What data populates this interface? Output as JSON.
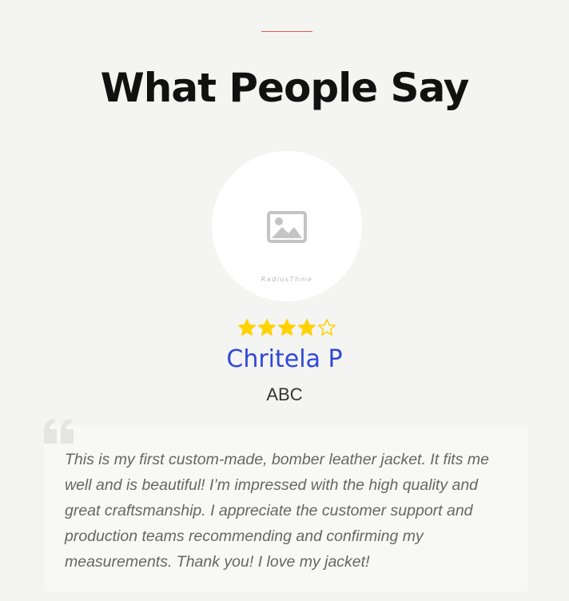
{
  "section": {
    "title": "What People Say",
    "accent_color": "#e8544a"
  },
  "testimonial": {
    "avatar_icon": "image-placeholder-icon",
    "avatar_watermark": "RadiusThme",
    "rating": 4,
    "rating_max": 5,
    "star_color": "#ffd200",
    "name": "Chritela P",
    "name_color": "#2f48d6",
    "company": "ABC",
    "quote_icon": "quote-icon",
    "quote": "This is my first custom-made, bomber leather jacket. It fits me well and is beautiful! I’m impressed with the high quality and great craftsmanship. I appreciate the customer support and production teams recommending and confirming my measurements. Thank you! I love my jacket!"
  }
}
